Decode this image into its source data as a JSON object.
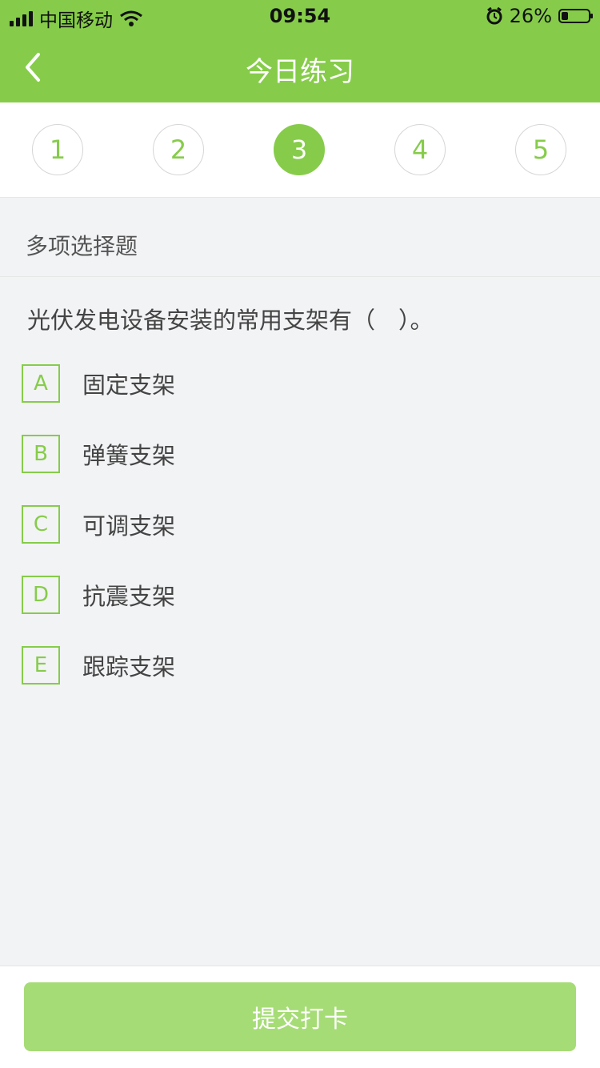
{
  "status": {
    "carrier": "中国移动",
    "time": "09:54",
    "battery": "26%",
    "battery_level": 0.26
  },
  "header": {
    "title": "今日练习"
  },
  "tabs": [
    {
      "label": "1",
      "active": false
    },
    {
      "label": "2",
      "active": false
    },
    {
      "label": "3",
      "active": true
    },
    {
      "label": "4",
      "active": false
    },
    {
      "label": "5",
      "active": false
    }
  ],
  "question_type": "多项选择题",
  "question": "光伏发电设备安装的常用支架有（　）。",
  "options": [
    {
      "letter": "A",
      "text": "固定支架"
    },
    {
      "letter": "B",
      "text": "弹簧支架"
    },
    {
      "letter": "C",
      "text": "可调支架"
    },
    {
      "letter": "D",
      "text": "抗震支架"
    },
    {
      "letter": "E",
      "text": "跟踪支架"
    }
  ],
  "submit_label": "提交打卡",
  "colors": {
    "accent": "#86cc4a",
    "button": "#a6dc76",
    "background": "#f2f3f5"
  }
}
